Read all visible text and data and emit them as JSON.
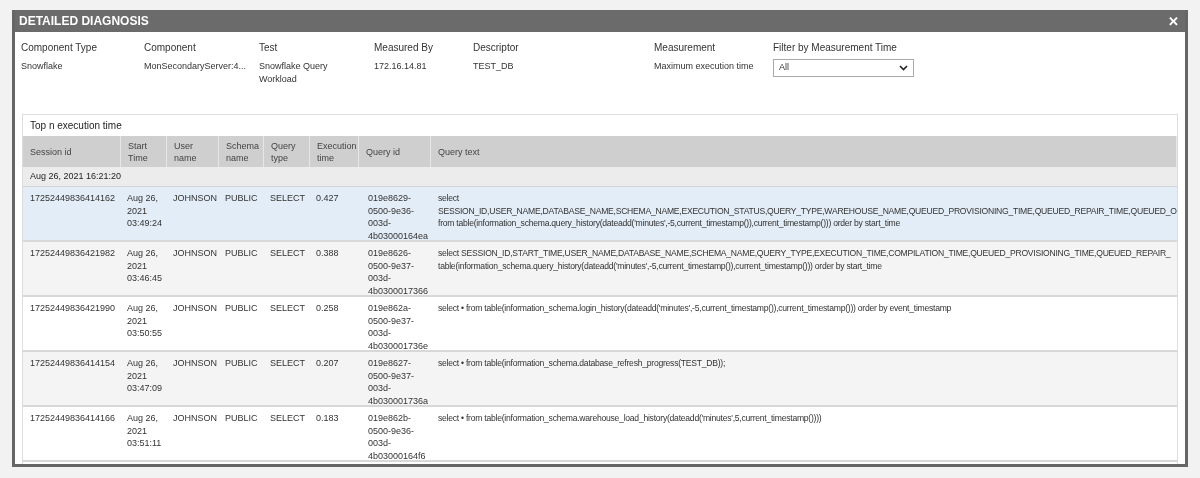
{
  "dialog": {
    "title": "DETAILED DIAGNOSIS",
    "close": "✕"
  },
  "info": [
    {
      "label": "Component Type",
      "value": "Snowflake"
    },
    {
      "label": "Component",
      "value": "MonSecondaryServer:4..."
    },
    {
      "label": "Test",
      "value": "Snowflake Query Workload"
    },
    {
      "label": "Measured By",
      "value": "172.16.14.81"
    },
    {
      "label": "Descriptor",
      "value": "TEST_DB"
    },
    {
      "label": "Measurement",
      "value": "Maximum execution time"
    }
  ],
  "filter": {
    "label": "Filter by Measurement Time",
    "value": "All"
  },
  "table": {
    "title": "Top n execution time",
    "columns": [
      "Session id",
      "Start Time",
      "User name",
      "Schema name",
      "Query type",
      "Execution time",
      "Query id",
      "Query text"
    ],
    "group": "Aug 26, 2021 16:21:20",
    "rows": [
      {
        "selected": true,
        "session_id": "17252449836414162",
        "start_time": "Aug 26, 2021 03:49:24",
        "user": "JOHNSON",
        "schema": "PUBLIC",
        "type": "SELECT",
        "exec": "0.427",
        "query_id": "019e8629-0500-9e36-003d-4b03000164ea",
        "query_text": [
          "select",
          "SESSION_ID,USER_NAME,DATABASE_NAME,SCHEMA_NAME,EXECUTION_STATUS,QUERY_TYPE,WAREHOUSE_NAME,QUEUED_PROVISIONING_TIME,QUEUED_REPAIR_TIME,QUEUED_O",
          "from table(information_schema.query_history(dateadd('minutes',-5,current_timestamp()),current_timestamp())) order by start_time"
        ]
      },
      {
        "selected": false,
        "session_id": "17252449836421982",
        "start_time": "Aug 26, 2021 03:46:45",
        "user": "JOHNSON",
        "schema": "PUBLIC",
        "type": "SELECT",
        "exec": "0.388",
        "query_id": "019e8626-0500-9e37-003d-4b0300017366",
        "query_text": [
          "select SESSION_ID,START_TIME,USER_NAME,DATABASE_NAME,SCHEMA_NAME,QUERY_TYPE,EXECUTION_TIME,COMPILATION_TIME,QUEUED_PROVISIONING_TIME,QUEUED_REPAIR_",
          "table(information_schema.query_history(dateadd('minutes',-5,current_timestamp()),current_timestamp())) order by start_time"
        ]
      },
      {
        "selected": false,
        "session_id": "17252449836421990",
        "start_time": "Aug 26, 2021 03:50:55",
        "user": "JOHNSON",
        "schema": "PUBLIC",
        "type": "SELECT",
        "exec": "0.258",
        "query_id": "019e862a-0500-9e37-003d-4b030001736e",
        "query_text": [
          "select • from table(information_schema.login_history(dateadd('minutes',-5,current_timestamp()),current_timestamp())) order by event_timestamp"
        ]
      },
      {
        "selected": false,
        "session_id": "17252449836414154",
        "start_time": "Aug 26, 2021 03:47:09",
        "user": "JOHNSON",
        "schema": "PUBLIC",
        "type": "SELECT",
        "exec": "0.207",
        "query_id": "019e8627-0500-9e37-003d-4b030001736a",
        "query_text": [
          "select • from table(information_schema.database_refresh_progress(TEST_DB));"
        ]
      },
      {
        "selected": false,
        "session_id": "17252449836414166",
        "start_time": "Aug 26, 2021 03:51:11",
        "user": "JOHNSON",
        "schema": "PUBLIC",
        "type": "SELECT",
        "exec": "0.183",
        "query_id": "019e862b-0500-9e36-003d-4b03000164f6",
        "query_text": [
          "select • from table(information_schema.warehouse_load_history(dateadd('minutes',5,current_timestamp())))"
        ]
      }
    ]
  }
}
